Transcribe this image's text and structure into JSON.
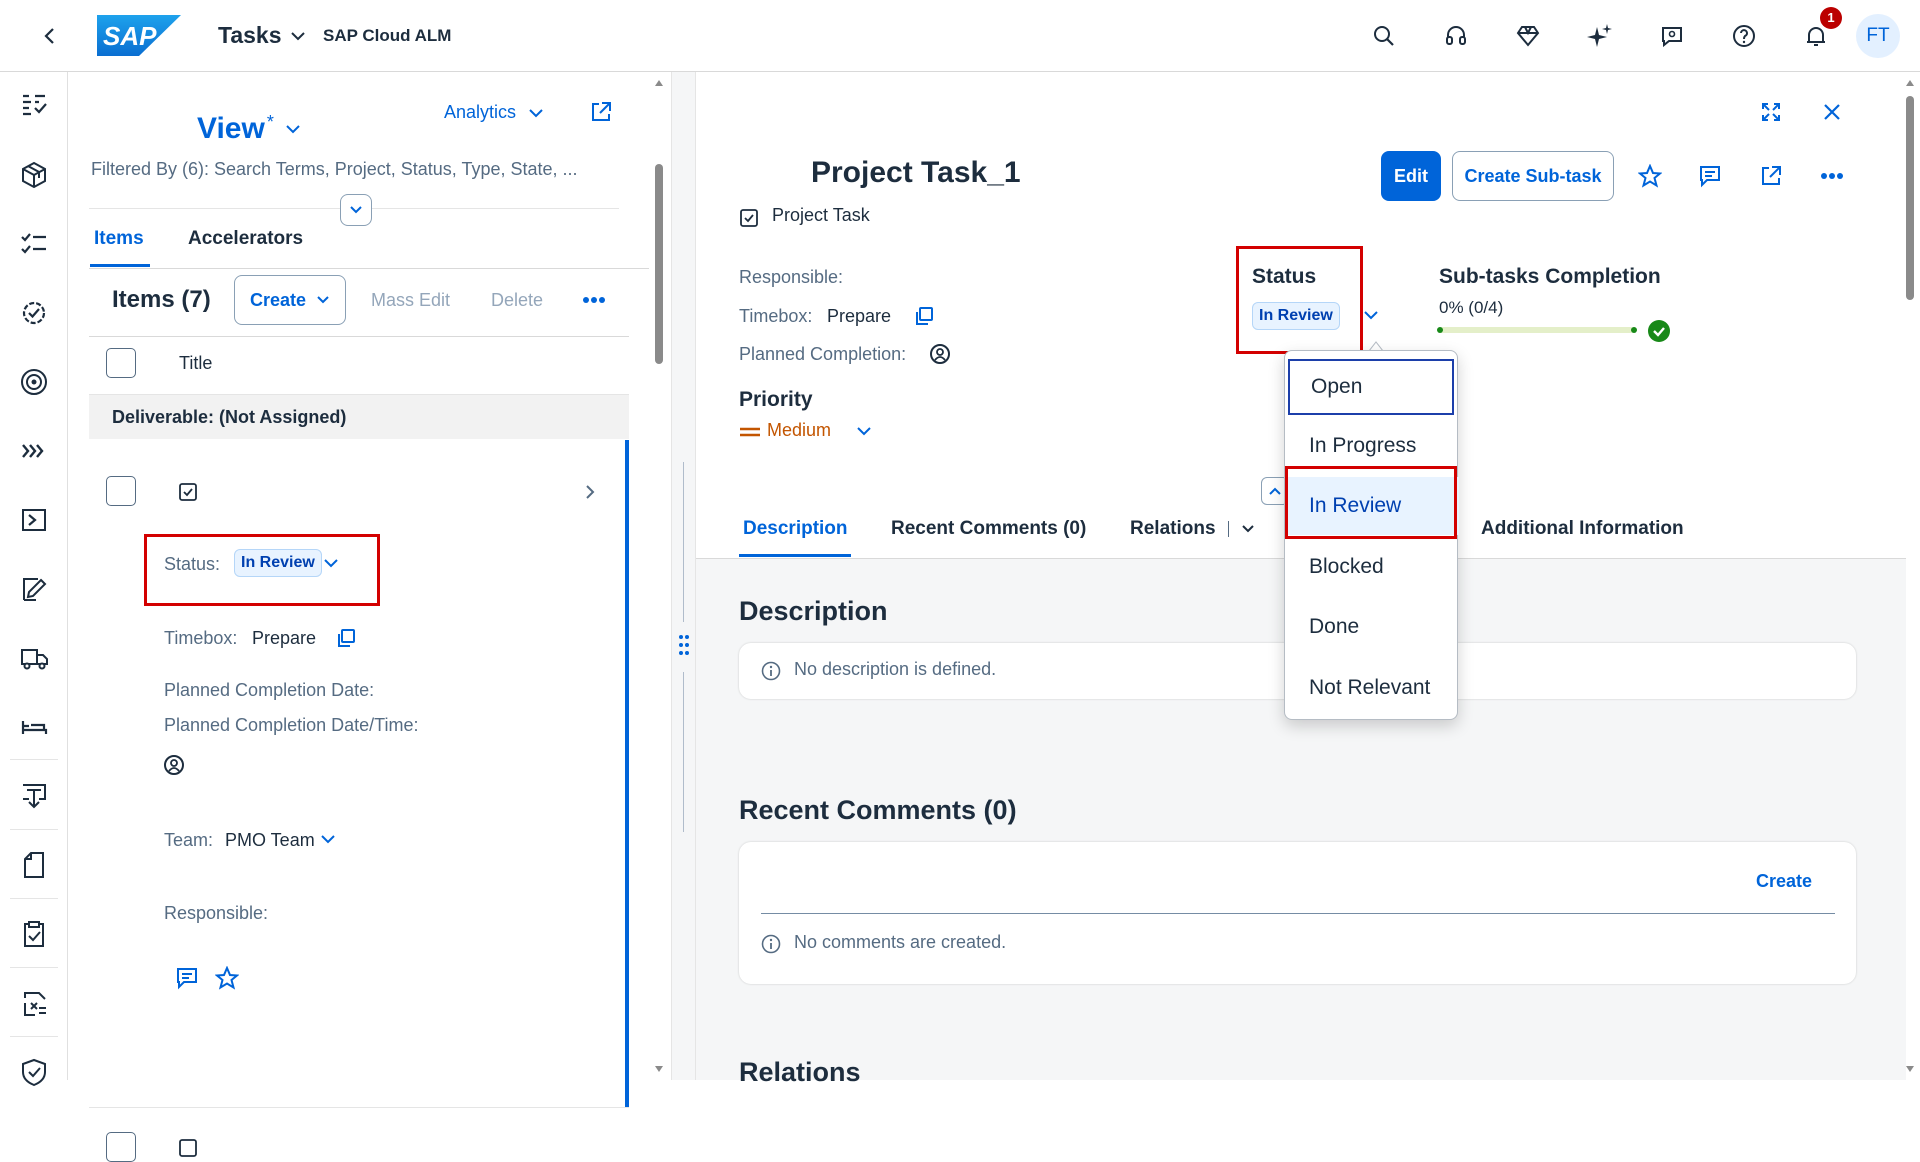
{
  "shell": {
    "logo_text": "SAP",
    "app_title": "Tasks",
    "product": "SAP Cloud ALM",
    "notification_count": "1",
    "avatar_initials": "FT",
    "icons": [
      "search-icon",
      "headset-icon",
      "diamond-icon",
      "sparkle-icon",
      "feedback-icon",
      "help-icon",
      "bell-icon"
    ]
  },
  "sidenav": {
    "icons": [
      "overview-icon",
      "cube-icon",
      "task-list-icon",
      "settings-check-icon",
      "target-icon",
      "chevrons-icon",
      "process-icon",
      "sign-icon",
      "truck-icon",
      "bed-icon",
      "download-doc-icon",
      "document-icon",
      "clipboard-check-icon",
      "clipboard-x-icon",
      "shield-check-icon"
    ]
  },
  "list": {
    "view_title": "View",
    "view_star": "*",
    "analytics_label": "Analytics",
    "filter_text": "Filtered By (6): Search Terms, Project, Status, Type, State, ...",
    "tabs": [
      "Items",
      "Accelerators"
    ],
    "items_header": "Items (7)",
    "create_label": "Create",
    "mass_edit_label": "Mass Edit",
    "delete_label": "Delete",
    "column_title": "Title",
    "group_header": "Deliverable: (Not Assigned)",
    "item": {
      "status_label": "Status:",
      "status_value": "In Review",
      "timebox_label": "Timebox:",
      "timebox_value": "Prepare",
      "planned_date_label": "Planned Completion Date:",
      "planned_datetime_label": "Planned Completion Date/Time:",
      "team_label": "Team:",
      "team_value": "PMO Team",
      "responsible_label": "Responsible:"
    }
  },
  "detail": {
    "title": "Project Task_1",
    "type": "Project Task",
    "edit_label": "Edit",
    "create_subtask_label": "Create Sub-task",
    "responsible_label": "Responsible:",
    "timebox_label": "Timebox:",
    "timebox_value": "Prepare",
    "planned_completion_label": "Planned Completion:",
    "status_heading": "Status",
    "status_value": "In Review",
    "subtasks_heading": "Sub-tasks Completion",
    "subtasks_value": "0% (0/4)",
    "subtasks_progress": 0,
    "priority_heading": "Priority",
    "priority_value": "Medium",
    "tabs": [
      "Description",
      "Recent Comments (0)",
      "Relations",
      "Additional Information"
    ],
    "description_heading": "Description",
    "description_empty": "No description is defined.",
    "comments_heading": "Recent Comments (0)",
    "comments_create": "Create",
    "comments_empty": "No comments are created.",
    "relations_heading": "Relations"
  },
  "status_menu": {
    "options": [
      "Open",
      "In Progress",
      "In Review",
      "Blocked",
      "Done",
      "Not Relevant"
    ],
    "selected": "In Review",
    "focused": "Open"
  },
  "colors": {
    "accent": "#0064d9",
    "highlight": "#d30000",
    "priority_medium": "#c35500",
    "success": "#188918"
  }
}
